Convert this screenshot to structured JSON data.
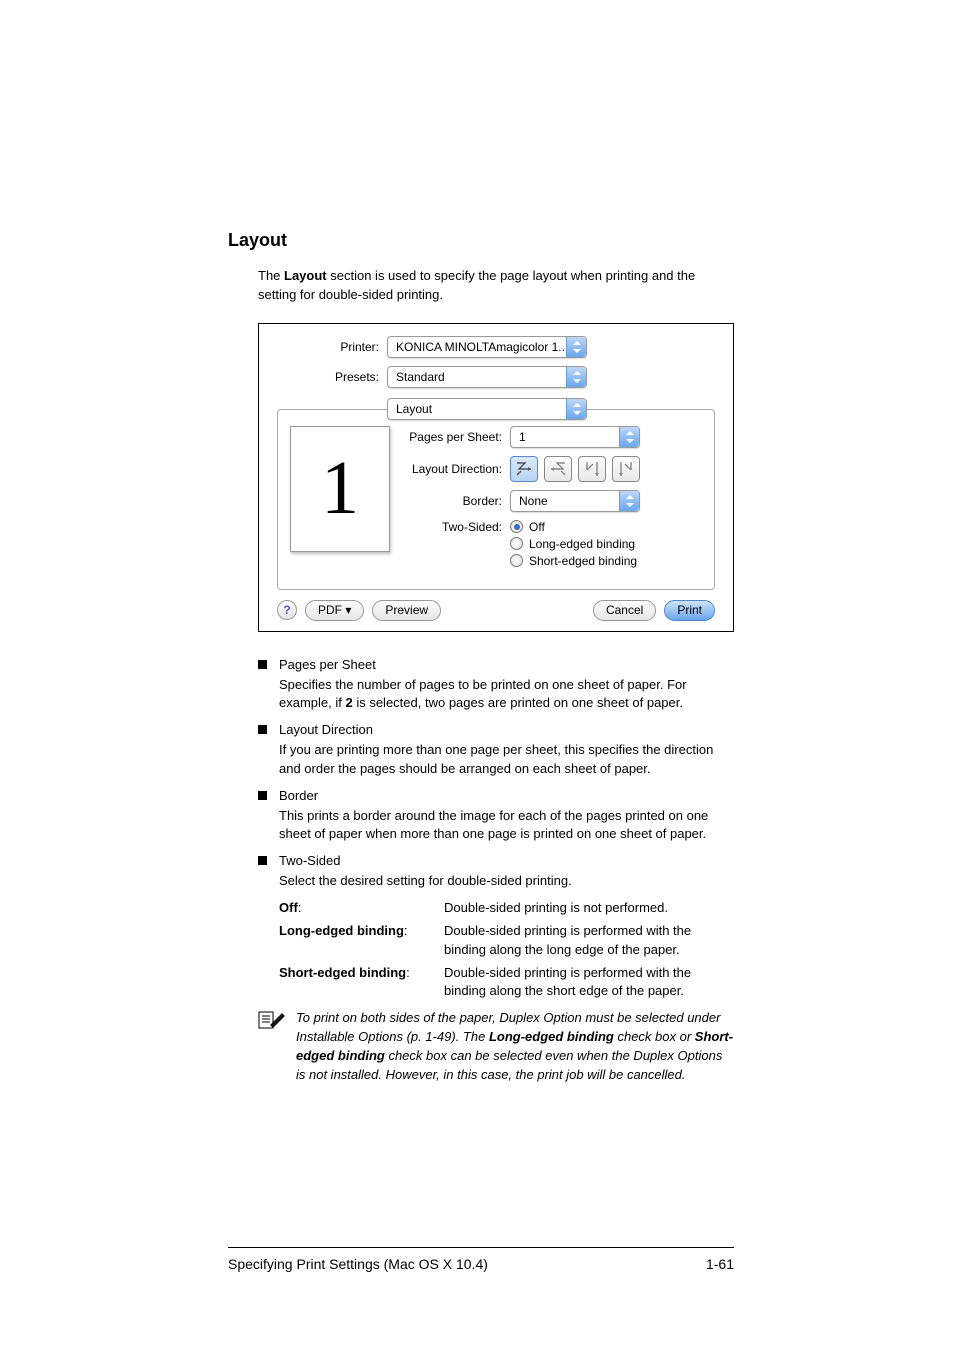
{
  "section_title": "Layout",
  "intro_pre": "The ",
  "intro_bold": "Layout",
  "intro_post": " section is used to specify the page layout when printing and the setting for double-sided printing.",
  "dialog": {
    "printer_label": "Printer:",
    "printer_value": "KONICA MINOLTAmagicolor 1...",
    "presets_label": "Presets:",
    "presets_value": "Standard",
    "panel_value": "Layout",
    "preview_number": "1",
    "pps_label": "Pages per Sheet:",
    "pps_value": "1",
    "dir_label": "Layout Direction:",
    "border_label": "Border:",
    "border_value": "None",
    "twosided_label": "Two-Sided:",
    "ts_off": "Off",
    "ts_long": "Long-edged binding",
    "ts_short": "Short-edged binding",
    "help_glyph": "?",
    "pdf_label": "PDF ▾",
    "preview_label": "Preview",
    "cancel_label": "Cancel",
    "print_label": "Print"
  },
  "bullets": {
    "pps": {
      "title": "Pages per Sheet",
      "body_a": "Specifies the number of pages to be printed on one sheet of paper. For example, if ",
      "body_bold": "2",
      "body_b": " is selected, two pages are printed on one sheet of paper."
    },
    "dir": {
      "title": "Layout Direction",
      "body": "If you are printing more than one page per sheet, this specifies the direction and order the pages should be arranged on each sheet of paper."
    },
    "border": {
      "title": "Border",
      "body": "This prints a border around the image for each of the pages printed on one sheet of paper when more than one page is printed on one sheet of paper."
    },
    "two": {
      "title": "Two-Sided",
      "body": "Select the desired setting for double-sided printing."
    }
  },
  "defs": {
    "off_term": "Off",
    "off_desc": "Double-sided printing is not performed.",
    "long_term": "Long-edged binding",
    "long_desc": "Double-sided printing is performed with the binding along the long edge of the paper.",
    "short_term": "Short-edged binding",
    "short_desc": "Double-sided printing is performed with the binding along the short edge of the paper."
  },
  "note": {
    "a": "To print on both sides of the paper, Duplex Option must be selected under Installable Options (p. 1-49). The ",
    "b1": "Long-edged binding",
    "c": " check box or ",
    "b2": "Short-edged binding",
    "d": " check box can be selected even when the Duplex Options is not installed. However, in this case, the print job will be cancelled."
  },
  "footer": {
    "left": "Specifying Print Settings (Mac OS X 10.4)",
    "right": "1-61"
  }
}
